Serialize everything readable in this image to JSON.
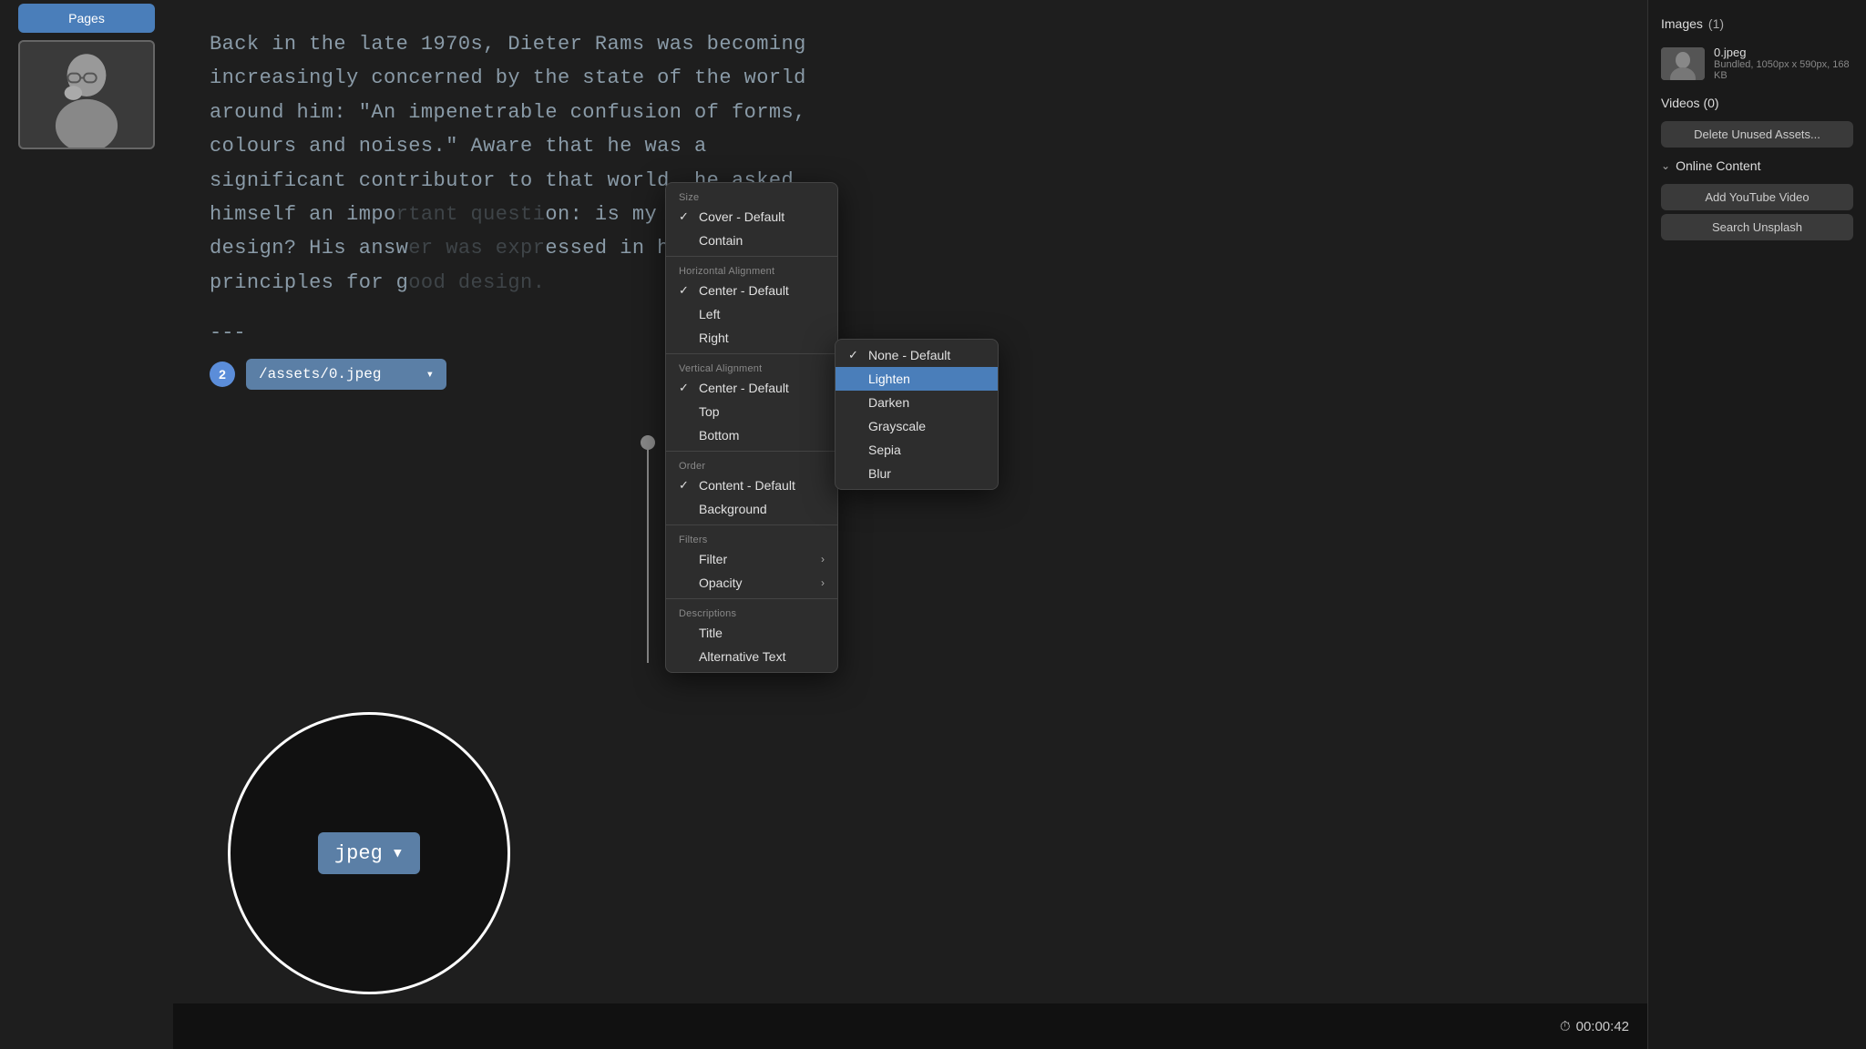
{
  "sidebar": {
    "active_tab": "Pages",
    "image_alt": "Person thinking"
  },
  "main": {
    "article_text": "Back in the late 1970s, Dieter Rams was becoming increasingly concerned by the state of the world around him: “An impenetrable confusion of forms, colours and noises.” Aware that he was a significant contributor to that world, he asked himself an important question: is my design good design? His answer was expressed in his ten principles for g",
    "article_text_end": "ood design.",
    "divider": "---",
    "step_number": "2",
    "asset_path": "/assets/0.jpeg",
    "timecode": "00:00:42"
  },
  "zoom_circle": {
    "label": "jpeg",
    "chevron": "▾"
  },
  "context_menu": {
    "sections": [
      {
        "label": "Size",
        "items": [
          {
            "text": "Cover - Default",
            "checked": true,
            "has_submenu": false
          },
          {
            "text": "Contain",
            "checked": false,
            "has_submenu": false
          }
        ]
      },
      {
        "label": "Horizontal Alignment",
        "items": [
          {
            "text": "Center - Default",
            "checked": true,
            "has_submenu": false
          },
          {
            "text": "Left",
            "checked": false,
            "has_submenu": false
          },
          {
            "text": "Right",
            "checked": false,
            "has_submenu": false
          }
        ]
      },
      {
        "label": "Vertical Alignment",
        "items": [
          {
            "text": "Center - Default",
            "checked": true,
            "has_submenu": false
          },
          {
            "text": "Top",
            "checked": false,
            "has_submenu": false
          },
          {
            "text": "Bottom",
            "checked": false,
            "has_submenu": false
          }
        ]
      },
      {
        "label": "Order",
        "items": [
          {
            "text": "Content - Default",
            "checked": true,
            "has_submenu": false
          },
          {
            "text": "Background",
            "checked": false,
            "has_submenu": false
          }
        ]
      },
      {
        "label": "Filters",
        "items": [
          {
            "text": "Filter",
            "checked": false,
            "has_submenu": true
          },
          {
            "text": "Opacity",
            "checked": false,
            "has_submenu": true
          }
        ]
      },
      {
        "label": "Descriptions",
        "items": [
          {
            "text": "Title",
            "checked": false,
            "has_submenu": false
          },
          {
            "text": "Alternative Text",
            "checked": false,
            "has_submenu": false
          }
        ]
      }
    ]
  },
  "submenu": {
    "items": [
      {
        "text": "None - Default",
        "checked": true,
        "highlighted": false
      },
      {
        "text": "Lighten",
        "checked": false,
        "highlighted": true
      },
      {
        "text": "Darken",
        "checked": false,
        "highlighted": false
      },
      {
        "text": "Grayscale",
        "checked": false,
        "highlighted": false
      },
      {
        "text": "Sepia",
        "checked": false,
        "highlighted": false
      },
      {
        "text": "Blur",
        "checked": false,
        "highlighted": false
      }
    ]
  },
  "right_panel": {
    "images_section_title": "Images",
    "images_count": "(1)",
    "image_item": {
      "name": "0.jpeg",
      "meta": "Bundled, 1050px x 590px, 168 KB"
    },
    "videos_section_title": "Videos",
    "videos_count": "(0)",
    "delete_unused_button": "Delete Unused Assets...",
    "online_content_section": "Online Content",
    "add_youtube_button": "Add YouTube Video",
    "search_unsplash_button": "Search Unsplash"
  },
  "icons": {
    "checkmark": "✓",
    "chevron_right": "›",
    "chevron_down": "⌄",
    "clock": "⏱",
    "dropdown_arrow": "▾"
  }
}
